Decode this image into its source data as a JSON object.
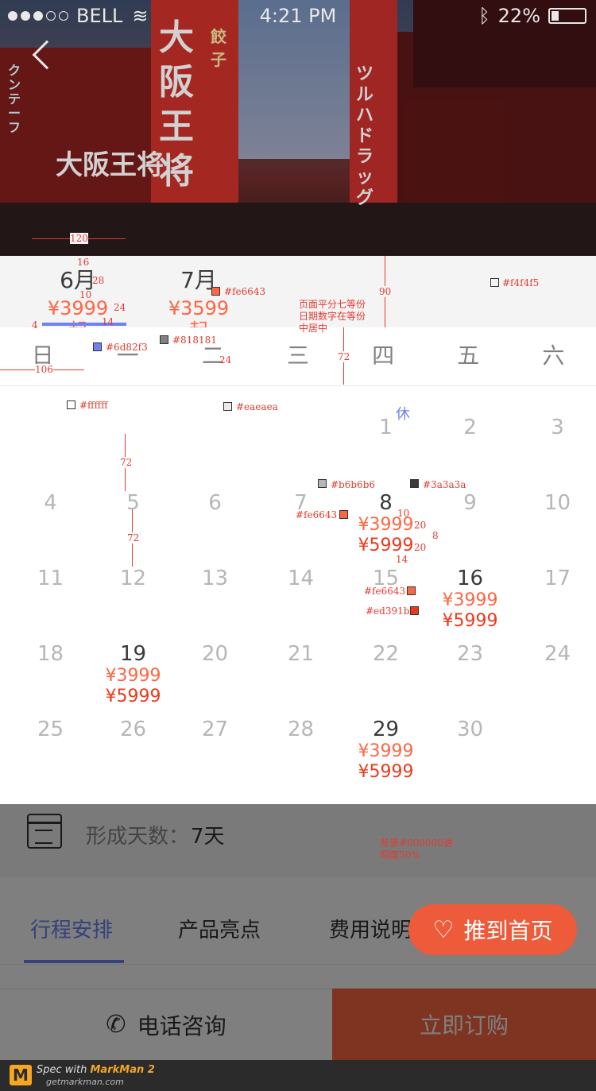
{
  "status_bar": {
    "carrier": "BELL",
    "time": "4:21 PM",
    "battery": "22%"
  },
  "months": [
    {
      "name": "6月",
      "price": "¥3999起",
      "active": true
    },
    {
      "name": "7月",
      "price": "¥3599起",
      "active": false
    }
  ],
  "weekdays": [
    "日",
    "一",
    "二",
    "三",
    "四",
    "五",
    "六"
  ],
  "calendar": {
    "rest_label": "休",
    "weeks": [
      [
        null,
        null,
        null,
        null,
        {
          "d": "1"
        },
        {
          "d": "2"
        },
        {
          "d": "3"
        }
      ],
      [
        {
          "d": "4"
        },
        {
          "d": "5"
        },
        {
          "d": "6"
        },
        {
          "d": "7"
        },
        {
          "d": "8",
          "p1": "¥3999",
          "p2": "¥5999"
        },
        {
          "d": "9"
        },
        {
          "d": "10"
        }
      ],
      [
        {
          "d": "11"
        },
        {
          "d": "12"
        },
        {
          "d": "13"
        },
        {
          "d": "14"
        },
        {
          "d": "15"
        },
        {
          "d": "16",
          "p1": "¥3999",
          "p2": "¥5999"
        },
        {
          "d": "17"
        }
      ],
      [
        {
          "d": "18"
        },
        {
          "d": "19",
          "p1": "¥3999",
          "p2": "¥5999"
        },
        {
          "d": "20"
        },
        {
          "d": "21"
        },
        {
          "d": "22"
        },
        {
          "d": "23"
        },
        {
          "d": "24"
        }
      ],
      [
        {
          "d": "25"
        },
        {
          "d": "26"
        },
        {
          "d": "27"
        },
        {
          "d": "28"
        },
        {
          "d": "29",
          "p1": "¥3999",
          "p2": "¥5999"
        },
        {
          "d": "30"
        },
        null
      ]
    ]
  },
  "days_info": {
    "label": "形成天数：",
    "value": "7天"
  },
  "tabs": [
    "行程安排",
    "产品亮点",
    "费用说明"
  ],
  "push_button": "推到首页",
  "call_button": "电话咨询",
  "buy_button": "立即订购",
  "footer": {
    "line1_prefix": "Spec with ",
    "line1_brand": "MarkMan 2",
    "line2": "getmarkman.com"
  },
  "annotations": {
    "month_bg": "#f4f4f5",
    "month_price_color": "#fe6643",
    "indicator_color": "#6d82f3",
    "weekday_color": "#818181",
    "divider_color": "#eaeaea",
    "cell_bg": "#ffffff",
    "disabled_color": "#b6b6b6",
    "available_color": "#3a3a3a",
    "price1_color": "#fe6643",
    "price2_color": "#ed391b",
    "layout_note": "页面平分七等份 日期数字在等份中居中",
    "overlay_note": "背景#000000透明度50%",
    "dims": [
      "120",
      "16",
      "28",
      "10",
      "24",
      "14",
      "4",
      "106",
      "24",
      "72",
      "90",
      "72",
      "72",
      "10",
      "20",
      "8",
      "20",
      "14"
    ]
  },
  "hero_signs": [
    "大阪王将",
    "ツルハドラッグ",
    "餃子",
    "大阪王将",
    "クンテーフ"
  ]
}
